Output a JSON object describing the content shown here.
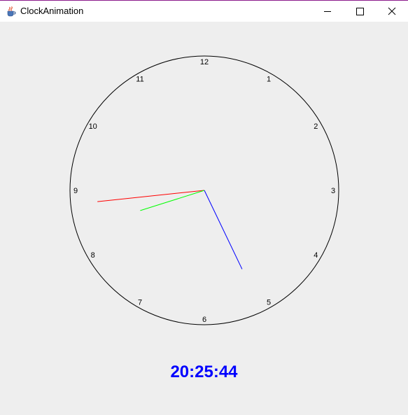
{
  "window": {
    "title": "ClockAnimation",
    "app_icon": "java-coffee-cup-icon",
    "controls": [
      "minimize-icon",
      "maximize-icon",
      "close-icon"
    ]
  },
  "clock": {
    "numerals": [
      "12",
      "1",
      "2",
      "3",
      "4",
      "5",
      "6",
      "7",
      "8",
      "9",
      "10",
      "11"
    ],
    "time": {
      "hour": 20,
      "minute": 25,
      "second": 44
    },
    "hand_colors": {
      "hour": "#00ff00",
      "minute": "#0000ff",
      "second": "#ff0000"
    },
    "face_outline_color": "#000000"
  },
  "digital_time": {
    "text": "20:25:44",
    "color": "#0000ff"
  }
}
